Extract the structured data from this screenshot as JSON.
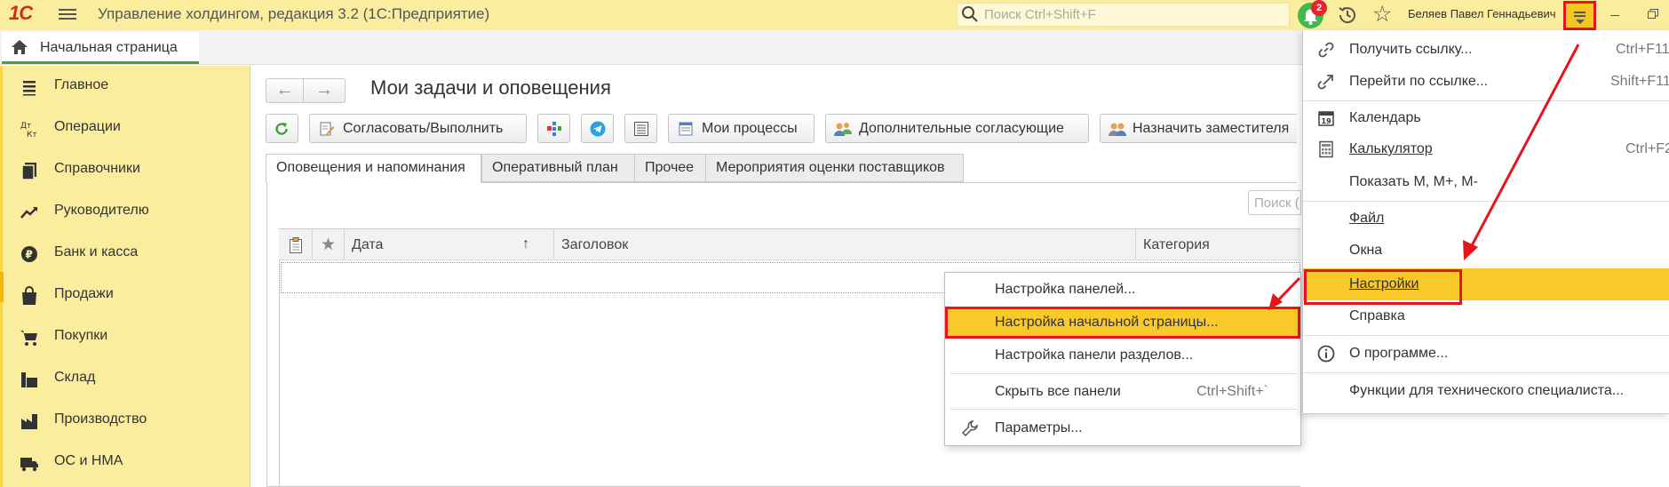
{
  "window": {
    "logo": "1С",
    "title": "Управление холдингом, редакция 3.2  (1С:Предприятие)",
    "search_placeholder": "Поиск Ctrl+Shift+F",
    "notifications_count": "2",
    "user": "Беляев Павел Геннадьевич"
  },
  "tabs": {
    "home": "Начальная страница"
  },
  "sidebar": {
    "items": [
      {
        "label": "Главное",
        "icon": "list-icon"
      },
      {
        "label": "Операции",
        "icon": "debit-credit-icon"
      },
      {
        "label": "Справочники",
        "icon": "books-icon"
      },
      {
        "label": "Руководителю",
        "icon": "trend-chart-icon"
      },
      {
        "label": "Банк и касса",
        "icon": "ruble-coin-icon"
      },
      {
        "label": "Продажи",
        "icon": "shopping-bag-icon"
      },
      {
        "label": "Покупки",
        "icon": "shopping-cart-icon"
      },
      {
        "label": "Склад",
        "icon": "warehouse-icon"
      },
      {
        "label": "Производство",
        "icon": "factory-icon"
      },
      {
        "label": "ОС и НМА",
        "icon": "truck-icon"
      }
    ]
  },
  "page": {
    "title": "Мои задачи и оповещения",
    "toolbar": {
      "approve": "Согласовать/Выполнить",
      "my_processes": "Мои процессы",
      "extra_approvers": "Дополнительные согласующие",
      "assign_deputy": "Назначить заместителя"
    },
    "tabs": [
      "Оповещения и напоминания",
      "Оперативный план",
      "Прочее",
      "Мероприятия оценки поставщиков"
    ],
    "search_placeholder": "Поиск (",
    "columns": {
      "date": "Дата",
      "sort_arrow": "↑",
      "title": "Заголовок",
      "category": "Категория"
    }
  },
  "context_menu": {
    "items": [
      {
        "label": "Настройка панелей..."
      },
      {
        "label": "Настройка начальной страницы..."
      },
      {
        "label": "Настройка панели разделов..."
      },
      {
        "label": "Скрыть все панели",
        "shortcut": "Ctrl+Shift+`"
      },
      {
        "label": "Параметры..."
      }
    ]
  },
  "main_menu": {
    "items": [
      {
        "label": "Получить ссылку...",
        "shortcut": "Ctrl+F11"
      },
      {
        "label": "Перейти по ссылке...",
        "shortcut": "Shift+F11"
      },
      {
        "label": "Календарь",
        "icon_text": "19"
      },
      {
        "label": "Калькулятор",
        "shortcut": "Ctrl+F2"
      },
      {
        "label": "Показать М, М+, М-"
      },
      {
        "label": "Файл"
      },
      {
        "label": "Окна"
      },
      {
        "label": "Настройки"
      },
      {
        "label": "Справка"
      },
      {
        "label": "О программе..."
      },
      {
        "label": "Функции для технического специалиста..."
      }
    ]
  },
  "colors": {
    "panel_yellow": "#fbed9e",
    "highlight": "#f9c82a",
    "annotation_red": "#e8141c",
    "notify_green": "#3fba4c"
  }
}
